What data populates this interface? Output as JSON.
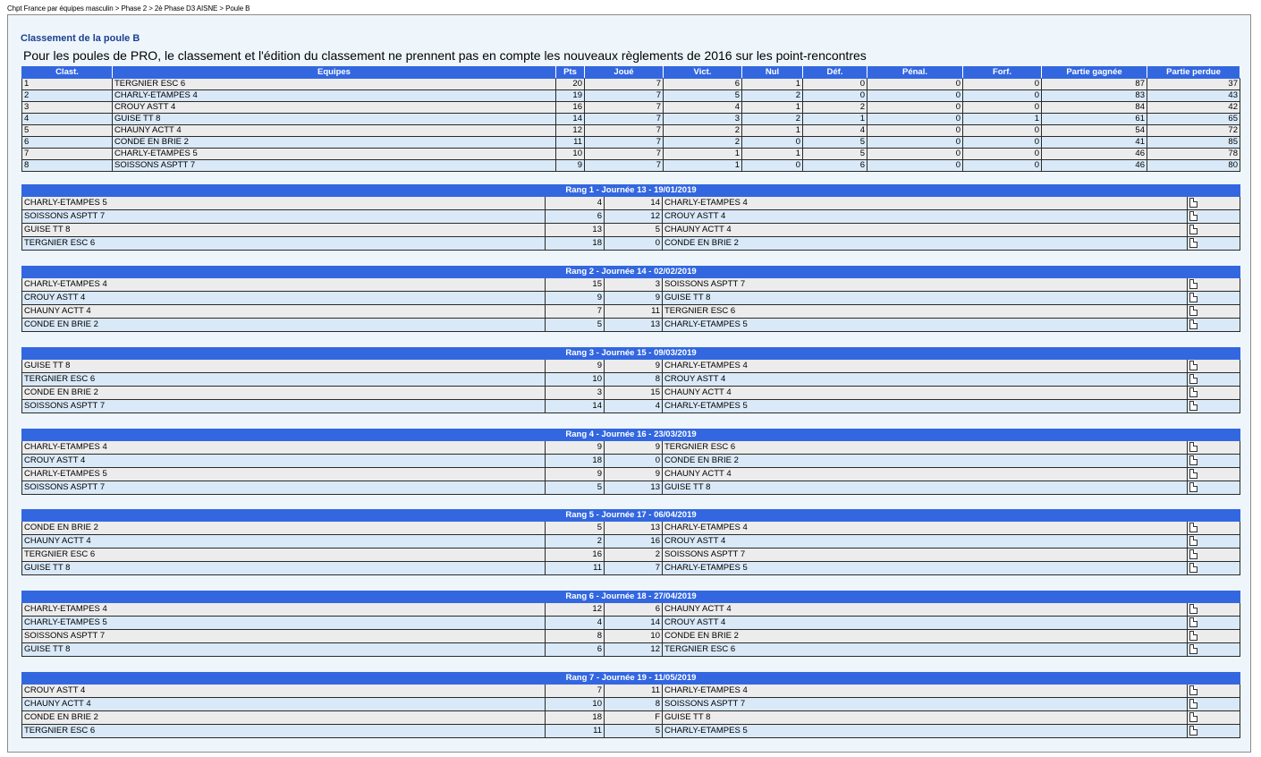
{
  "breadcrumb": "Chpt France par équipes masculin > Phase 2 > 2è Phase D3 AISNE > Poule B",
  "title": "Classement de la poule B",
  "notice": "Pour les poules de PRO, le classement et l'édition du classement ne prennent pas en compte les nouveaux règlements de 2016 sur les point-rencontres",
  "standings": {
    "headers": [
      "Clast.",
      "Equipes",
      "Pts",
      "Joué",
      "Vict.",
      "Nul",
      "Déf.",
      "Pénal.",
      "Forf.",
      "Partie gagnée",
      "Partie perdue"
    ],
    "rows": [
      [
        "1",
        "TERGNIER ESC 6",
        "20",
        "7",
        "6",
        "1",
        "0",
        "0",
        "0",
        "87",
        "37"
      ],
      [
        "2",
        "CHARLY-ETAMPES 4",
        "19",
        "7",
        "5",
        "2",
        "0",
        "0",
        "0",
        "83",
        "43"
      ],
      [
        "3",
        "CROUY ASTT 4",
        "16",
        "7",
        "4",
        "1",
        "2",
        "0",
        "0",
        "84",
        "42"
      ],
      [
        "4",
        "GUISE TT 8",
        "14",
        "7",
        "3",
        "2",
        "1",
        "0",
        "1",
        "61",
        "65"
      ],
      [
        "5",
        "CHAUNY ACTT 4",
        "12",
        "7",
        "2",
        "1",
        "4",
        "0",
        "0",
        "54",
        "72"
      ],
      [
        "6",
        "CONDE EN BRIE 2",
        "11",
        "7",
        "2",
        "0",
        "5",
        "0",
        "0",
        "41",
        "85"
      ],
      [
        "7",
        "CHARLY-ETAMPES 5",
        "10",
        "7",
        "1",
        "1",
        "5",
        "0",
        "0",
        "46",
        "78"
      ],
      [
        "8",
        "SOISSONS ASPTT 7",
        "9",
        "7",
        "1",
        "0",
        "6",
        "0",
        "0",
        "46",
        "80"
      ]
    ]
  },
  "rounds": [
    {
      "title": "Rang 1 - Journée 13 - 19/01/2019",
      "matches": [
        [
          "CHARLY-ETAMPES 5",
          "4",
          "14",
          "CHARLY-ETAMPES 4"
        ],
        [
          "SOISSONS ASPTT 7",
          "6",
          "12",
          "CROUY ASTT 4"
        ],
        [
          "GUISE TT 8",
          "13",
          "5",
          "CHAUNY ACTT 4"
        ],
        [
          "TERGNIER ESC 6",
          "18",
          "0",
          "CONDE EN BRIE 2"
        ]
      ]
    },
    {
      "title": "Rang 2 - Journée 14 - 02/02/2019",
      "matches": [
        [
          "CHARLY-ETAMPES 4",
          "15",
          "3",
          "SOISSONS ASPTT 7"
        ],
        [
          "CROUY ASTT 4",
          "9",
          "9",
          "GUISE TT 8"
        ],
        [
          "CHAUNY ACTT 4",
          "7",
          "11",
          "TERGNIER ESC 6"
        ],
        [
          "CONDE EN BRIE 2",
          "5",
          "13",
          "CHARLY-ETAMPES 5"
        ]
      ]
    },
    {
      "title": "Rang 3 - Journée 15 - 09/03/2019",
      "matches": [
        [
          "GUISE TT 8",
          "9",
          "9",
          "CHARLY-ETAMPES 4"
        ],
        [
          "TERGNIER ESC 6",
          "10",
          "8",
          "CROUY ASTT 4"
        ],
        [
          "CONDE EN BRIE 2",
          "3",
          "15",
          "CHAUNY ACTT 4"
        ],
        [
          "SOISSONS ASPTT 7",
          "14",
          "4",
          "CHARLY-ETAMPES 5"
        ]
      ]
    },
    {
      "title": "Rang 4 - Journée 16 - 23/03/2019",
      "matches": [
        [
          "CHARLY-ETAMPES 4",
          "9",
          "9",
          "TERGNIER ESC 6"
        ],
        [
          "CROUY ASTT 4",
          "18",
          "0",
          "CONDE EN BRIE 2"
        ],
        [
          "CHARLY-ETAMPES 5",
          "9",
          "9",
          "CHAUNY ACTT 4"
        ],
        [
          "SOISSONS ASPTT 7",
          "5",
          "13",
          "GUISE TT 8"
        ]
      ]
    },
    {
      "title": "Rang 5 - Journée 17 - 06/04/2019",
      "matches": [
        [
          "CONDE EN BRIE 2",
          "5",
          "13",
          "CHARLY-ETAMPES 4"
        ],
        [
          "CHAUNY ACTT 4",
          "2",
          "16",
          "CROUY ASTT 4"
        ],
        [
          "TERGNIER ESC 6",
          "16",
          "2",
          "SOISSONS ASPTT 7"
        ],
        [
          "GUISE TT 8",
          "11",
          "7",
          "CHARLY-ETAMPES 5"
        ]
      ]
    },
    {
      "title": "Rang 6 - Journée 18 - 27/04/2019",
      "matches": [
        [
          "CHARLY-ETAMPES 4",
          "12",
          "6",
          "CHAUNY ACTT 4"
        ],
        [
          "CHARLY-ETAMPES 5",
          "4",
          "14",
          "CROUY ASTT 4"
        ],
        [
          "SOISSONS ASPTT 7",
          "8",
          "10",
          "CONDE EN BRIE 2"
        ],
        [
          "GUISE TT 8",
          "6",
          "12",
          "TERGNIER ESC 6"
        ]
      ]
    },
    {
      "title": "Rang 7 - Journée 19 - 11/05/2019",
      "matches": [
        [
          "CROUY ASTT 4",
          "7",
          "11",
          "CHARLY-ETAMPES 4"
        ],
        [
          "CHAUNY ACTT 4",
          "10",
          "8",
          "SOISSONS ASPTT 7"
        ],
        [
          "CONDE EN BRIE 2",
          "18",
          "F",
          "GUISE TT 8"
        ],
        [
          "TERGNIER ESC 6",
          "11",
          "5",
          "CHARLY-ETAMPES 5"
        ]
      ]
    }
  ],
  "colors": {
    "header_bg": "#3367e0",
    "row_odd": "#ececec",
    "row_even": "#d9e9f8",
    "title": "#1b3f8f",
    "frame_bg": "#eef6fc"
  },
  "icons": {
    "match_sheet": "document-icon"
  }
}
